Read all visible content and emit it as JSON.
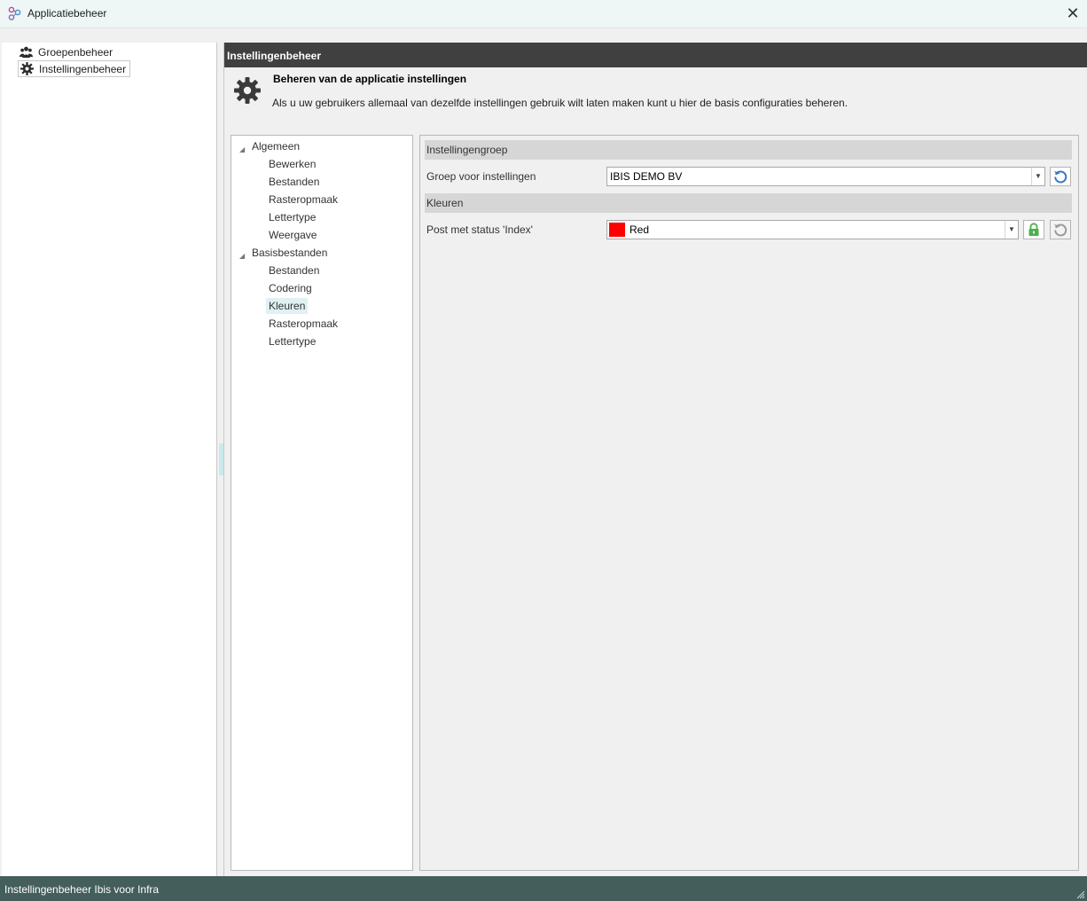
{
  "window": {
    "title": "Applicatiebeheer",
    "close_glyph": "✕"
  },
  "nav": {
    "items": [
      {
        "label": "Groepenbeheer",
        "icon": "users-icon"
      },
      {
        "label": "Instellingenbeheer",
        "icon": "gear-icon",
        "selected": true
      }
    ]
  },
  "content": {
    "header": "Instellingenbeheer",
    "title": "Beheren van de applicatie instellingen",
    "description": "Als u uw gebruikers allemaal van dezelfde instellingen gebruik wilt laten maken kunt u hier de basis configuraties beheren."
  },
  "tree": {
    "groups": [
      {
        "label": "Algemeen",
        "children": [
          "Bewerken",
          "Bestanden",
          "Rasteropmaak",
          "Lettertype",
          "Weergave"
        ]
      },
      {
        "label": "Basisbestanden",
        "children": [
          "Bestanden",
          "Codering",
          "Kleuren",
          "Rasteropmaak",
          "Lettertype"
        ]
      }
    ],
    "selected": "Kleuren"
  },
  "settings": {
    "group1": {
      "header": "Instellingengroep",
      "row_label": "Groep voor instellingen",
      "value": "IBIS DEMO BV"
    },
    "group2": {
      "header": "Kleuren",
      "row_label": "Post met status 'Index'",
      "value": "Red",
      "swatch_color": "#ff0000"
    }
  },
  "colors": {
    "accent_blue": "#3579c4",
    "lock_green": "#4caf50",
    "header_dark": "#404040",
    "statusbar": "#435e5b"
  },
  "statusbar": {
    "text": "Instellingenbeheer Ibis voor Infra"
  }
}
